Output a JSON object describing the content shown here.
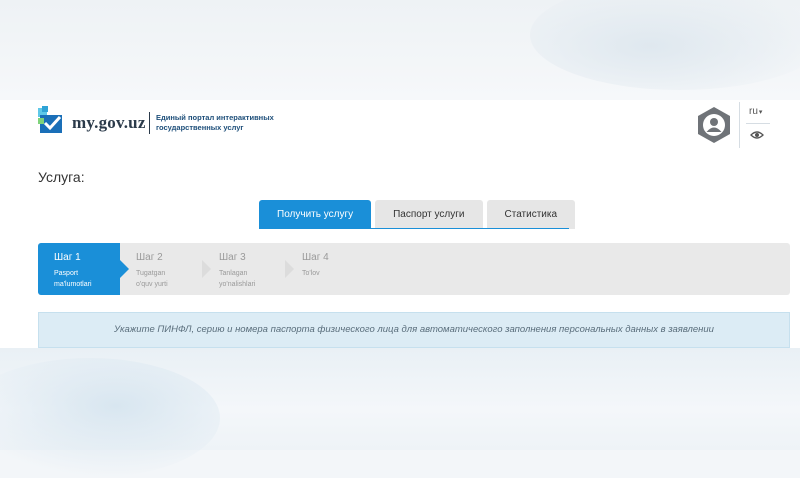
{
  "header": {
    "brand": "my.gov.uz",
    "tagline_line1": "Единый портал интерактивных",
    "tagline_line2": "государственных услуг",
    "language": "ru",
    "colors": {
      "accent": "#1a8fd8",
      "brand_dark": "#2b3a4a",
      "tagline": "#1e4f7a"
    }
  },
  "page": {
    "title": "Услуга:"
  },
  "tabs": [
    {
      "label": "Получить услугу",
      "active": true
    },
    {
      "label": "Паспорт услуги",
      "active": false
    },
    {
      "label": "Статистика",
      "active": false
    }
  ],
  "steps": [
    {
      "number": "Шаг 1",
      "desc_line1": "Pasport",
      "desc_line2": "ma'lumotlari",
      "active": true
    },
    {
      "number": "Шаг 2",
      "desc_line1": "Tugatgan",
      "desc_line2": "o'quv yurti",
      "active": false
    },
    {
      "number": "Шаг 3",
      "desc_line1": "Tanlagan",
      "desc_line2": "yo'nalishlari",
      "active": false
    },
    {
      "number": "Шаг 4",
      "desc_line1": "To'lov",
      "desc_line2": "",
      "active": false
    }
  ],
  "info": {
    "message": "Укажите ПИНФЛ, серию и номера паспорта физического лица для автоматического заполнения персональных данных в заявлении"
  },
  "icons": {
    "logo": "checkmark-logo-icon",
    "avatar": "user-avatar-icon",
    "language_caret": "chevron-down-icon",
    "accessibility": "eye-icon"
  }
}
